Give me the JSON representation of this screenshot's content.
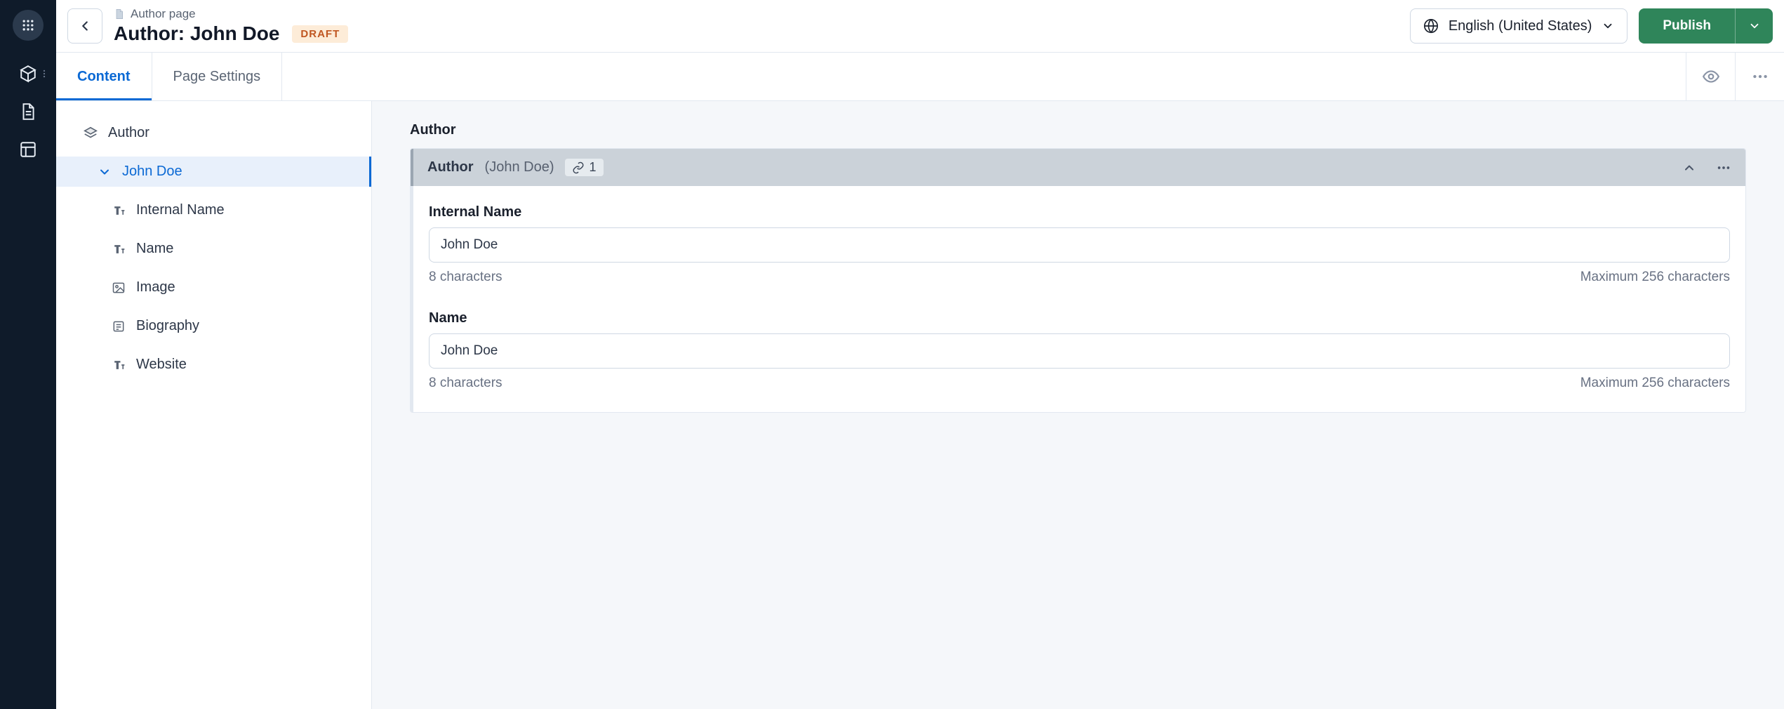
{
  "header": {
    "breadcrumb": "Author page",
    "title": "Author: John Doe",
    "status_badge": "DRAFT",
    "locale": "English (United States)",
    "publish_label": "Publish"
  },
  "tabs": {
    "content": "Content",
    "page_settings": "Page Settings"
  },
  "tree": {
    "root_label": "Author",
    "selected_label": "John Doe",
    "fields": [
      {
        "icon": "text",
        "label": "Internal Name"
      },
      {
        "icon": "text",
        "label": "Name"
      },
      {
        "icon": "image",
        "label": "Image"
      },
      {
        "icon": "richtext",
        "label": "Biography"
      },
      {
        "icon": "text",
        "label": "Website"
      }
    ]
  },
  "content": {
    "section_label": "Author",
    "card": {
      "title": "Author",
      "subtitle": "(John Doe)",
      "link_count": "1"
    },
    "fields": [
      {
        "label": "Internal Name",
        "value": "John Doe",
        "count": "8 characters",
        "max": "Maximum 256 characters"
      },
      {
        "label": "Name",
        "value": "John Doe",
        "count": "8 characters",
        "max": "Maximum 256 characters"
      }
    ]
  }
}
